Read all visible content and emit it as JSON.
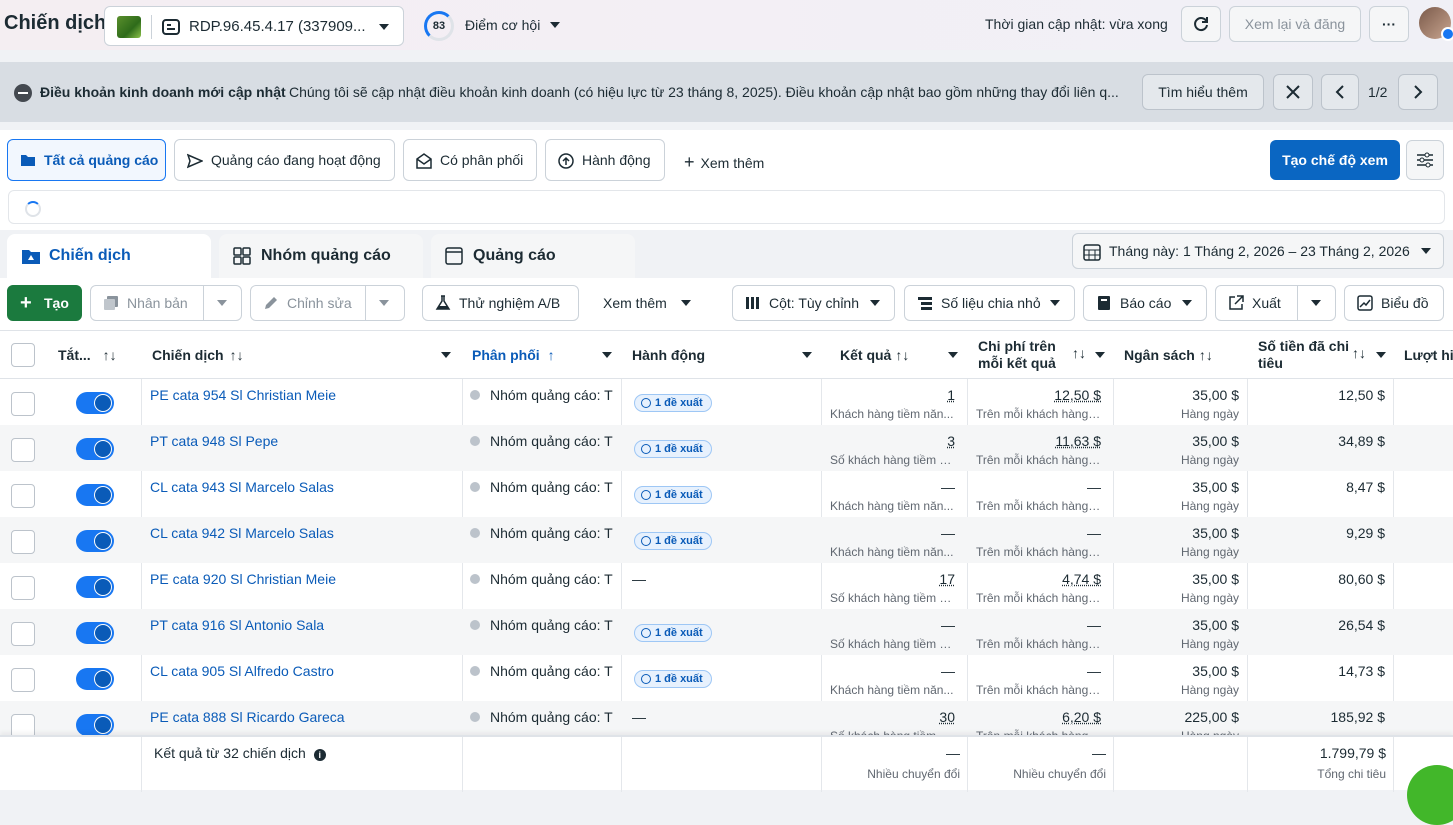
{
  "header": {
    "title": "Chiến dịch",
    "account_name": "RDP.96.45.4.17 (337909...",
    "opportunity_score": "83",
    "opportunity_label": "Điểm cơ hội",
    "update_time": "Thời gian cập nhật: vừa xong",
    "review_publish": "Xem lại và đăng",
    "more": "···"
  },
  "banner": {
    "title": "Điều khoản kinh doanh mới cập nhật",
    "message": "Chúng tôi sẽ cập nhật điều khoản kinh doanh (có hiệu lực từ 23 tháng 8, 2025). Điều khoản cập nhật bao gồm những thay đổi liên q...",
    "learn_more": "Tìm hiểu thêm",
    "pager": "1/2"
  },
  "filters": {
    "all_ads": "Tất cả quảng cáo",
    "active_ads": "Quảng cáo đang hoạt động",
    "delivering": "Có phân phối",
    "actions": "Hành động",
    "see_more": "Xem thêm",
    "create_view": "Tạo chế độ xem"
  },
  "tabs": {
    "campaigns": "Chiến dịch",
    "ad_sets": "Nhóm quảng cáo",
    "ads": "Quảng cáo"
  },
  "date_range": "Tháng này: 1 Tháng 2, 2026 – 23 Tháng 2, 2026",
  "toolbar": {
    "create": "Tạo",
    "duplicate": "Nhân bản",
    "edit": "Chỉnh sửa",
    "ab_test": "Thử nghiệm A/B",
    "see_more": "Xem thêm",
    "columns": "Cột: Tùy chỉnh",
    "breakdown": "Số liệu chia nhỏ",
    "reports": "Báo cáo",
    "export": "Xuất",
    "charts": "Biểu đồ"
  },
  "columns": {
    "onoff": "Tắt...",
    "campaign": "Chiến dịch",
    "delivery": "Phân phối",
    "actions": "Hành động",
    "results": "Kết quả",
    "cost_line1": "Chi phí trên",
    "cost_line2": "mỗi kết quả",
    "budget": "Ngân sách",
    "spent_line1": "Số tiền đã chi",
    "spent_line2": "tiêu",
    "reach": "Lượt hi"
  },
  "rows": [
    {
      "name": "PE cata 954 Sl Christian Meie",
      "delivery": "Nhóm quảng cáo: T",
      "action": "1 đề xuất",
      "result": "1",
      "result_sub": "Khách hàng tiềm năn...",
      "cost": "12,50 $",
      "cost_sub": "Trên mỗi khách hàng ...",
      "budget": "35,00 $",
      "budget_sub": "Hàng ngày",
      "spent": "12,50 $"
    },
    {
      "name": "PT cata 948 Sl Pepe",
      "delivery": "Nhóm quảng cáo: T",
      "action": "1 đề xuất",
      "result": "3",
      "result_sub": "Số khách hàng tiềm n...",
      "cost": "11,63 $",
      "cost_sub": "Trên mỗi khách hàng ...",
      "budget": "35,00 $",
      "budget_sub": "Hàng ngày",
      "spent": "34,89 $"
    },
    {
      "name": "CL cata 943 Sl Marcelo Salas",
      "delivery": "Nhóm quảng cáo: T",
      "action": "1 đề xuất",
      "result": "—",
      "result_sub": "Khách hàng tiềm năn...",
      "cost": "—",
      "cost_sub": "Trên mỗi khách hàng t...",
      "budget": "35,00 $",
      "budget_sub": "Hàng ngày",
      "spent": "8,47 $"
    },
    {
      "name": "CL cata 942 Sl Marcelo Salas",
      "delivery": "Nhóm quảng cáo: T",
      "action": "1 đề xuất",
      "result": "—",
      "result_sub": "Khách hàng tiềm năn...",
      "cost": "—",
      "cost_sub": "Trên mỗi khách hàng t...",
      "budget": "35,00 $",
      "budget_sub": "Hàng ngày",
      "spent": "9,29 $"
    },
    {
      "name": "PE cata 920 Sl Christian Meie",
      "delivery": "Nhóm quảng cáo: T",
      "action": "—",
      "result": "17",
      "result_sub": "Số khách hàng tiềm n...",
      "cost": "4,74 $",
      "cost_sub": "Trên mỗi khách hàng ...",
      "budget": "35,00 $",
      "budget_sub": "Hàng ngày",
      "spent": "80,60 $"
    },
    {
      "name": "PT cata 916 Sl Antonio Sala",
      "delivery": "Nhóm quảng cáo: T",
      "action": "1 đề xuất",
      "result": "—",
      "result_sub": "Số khách hàng tiềm n...",
      "cost": "—",
      "cost_sub": "Trên mỗi khách hàng t...",
      "budget": "35,00 $",
      "budget_sub": "Hàng ngày",
      "spent": "26,54 $"
    },
    {
      "name": "CL cata 905 Sl Alfredo Castro",
      "delivery": "Nhóm quảng cáo: T",
      "action": "1 đề xuất",
      "result": "—",
      "result_sub": "Khách hàng tiềm năn...",
      "cost": "—",
      "cost_sub": "Trên mỗi khách hàng t...",
      "budget": "35,00 $",
      "budget_sub": "Hàng ngày",
      "spent": "14,73 $"
    },
    {
      "name": "PE cata 888 Sl Ricardo Gareca",
      "delivery": "Nhóm quảng cáo: T",
      "action": "—",
      "result": "30",
      "result_sub": "Số khách hàng tiềm n...",
      "cost": "6,20 $",
      "cost_sub": "Trên mỗi khách hàng ...",
      "budget": "225,00 $",
      "budget_sub": "Hàng ngày",
      "spent": "185,92 $"
    }
  ],
  "footer": {
    "label": "Kết quả từ 32 chiến dịch",
    "results": "—",
    "results_sub": "Nhiều chuyển đổi",
    "cost": "—",
    "cost_sub": "Nhiều chuyển đổi",
    "spent": "1.799,79 $",
    "spent_sub": "Tổng chi tiêu"
  },
  "colors": {
    "accent": "#0a66c2",
    "link": "#0a5bb8",
    "toggle": "#1877f2"
  }
}
